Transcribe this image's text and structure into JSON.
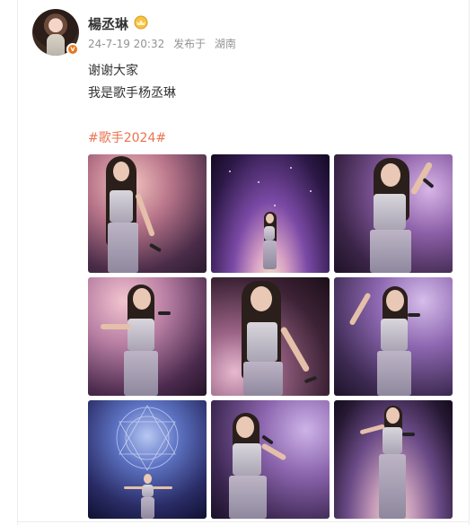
{
  "post": {
    "username": "楊丞琳",
    "timestamp": "24-7-19 20:32",
    "source_prefix": "发布于",
    "location": "湖南",
    "lines": [
      "谢谢大家",
      "我是歌手杨丞琳"
    ],
    "hashtag": "#歌手2024#"
  },
  "icons": {
    "verified": "verified-badge-icon",
    "vip": "vip-crown-icon"
  },
  "colors": {
    "username": "#333333",
    "meta": "#939393",
    "hashtag": "#eb7350",
    "verified": "#e8781e"
  },
  "photos": [
    {
      "label": "photo-1"
    },
    {
      "label": "photo-2"
    },
    {
      "label": "photo-3"
    },
    {
      "label": "photo-4"
    },
    {
      "label": "photo-5"
    },
    {
      "label": "photo-6"
    },
    {
      "label": "photo-7"
    },
    {
      "label": "photo-8"
    },
    {
      "label": "photo-9"
    }
  ]
}
